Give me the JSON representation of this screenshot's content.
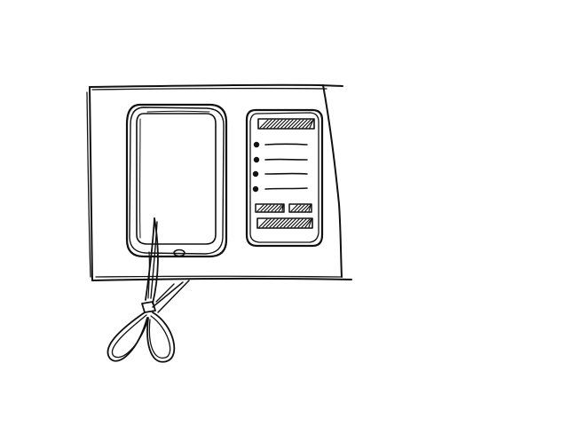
{
  "sketch": {
    "style": "hand-drawn pencil wireframe",
    "stroke_color": "#111111",
    "background": "#ffffff",
    "items": [
      "board",
      "phone-outline",
      "content-card",
      "bulleted-list",
      "two-buttons",
      "scissors"
    ],
    "list_bullet_count": 4,
    "button_count": 2
  }
}
